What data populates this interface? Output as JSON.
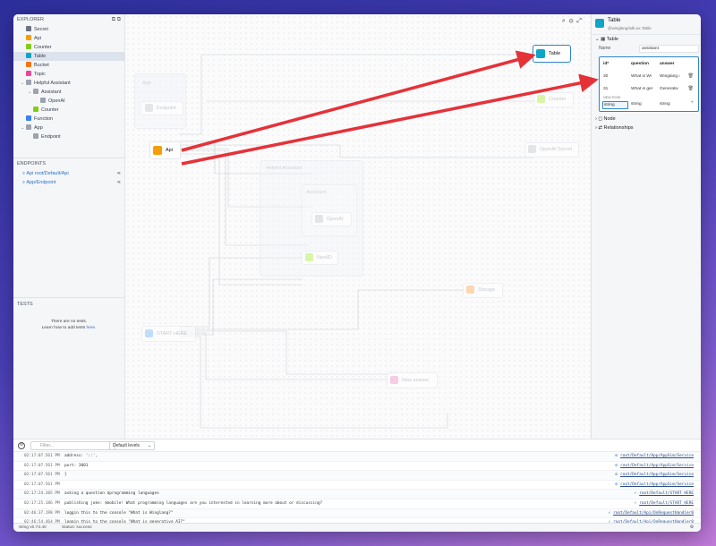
{
  "explorer": {
    "title": "EXPLORER",
    "items": [
      {
        "label": "Secret",
        "color": "#6b7280",
        "indent": 0
      },
      {
        "label": "Api",
        "color": "#f59e0b",
        "indent": 0
      },
      {
        "label": "Counter",
        "color": "#84cc16",
        "indent": 0
      },
      {
        "label": "Table",
        "color": "#0ea5c6",
        "indent": 0,
        "selected": true
      },
      {
        "label": "Bucket",
        "color": "#f97316",
        "indent": 0
      },
      {
        "label": "Topic",
        "color": "#ec4899",
        "indent": 0
      },
      {
        "label": "Helpful Assistant",
        "color": "#9ca3af",
        "indent": 0,
        "expanded": true
      },
      {
        "label": "Assistant",
        "color": "#9ca3af",
        "indent": 1,
        "expanded": true
      },
      {
        "label": "OpenAI",
        "color": "#9ca3af",
        "indent": 2
      },
      {
        "label": "Counter",
        "color": "#84cc16",
        "indent": 1
      },
      {
        "label": "Function",
        "color": "#3b82f6",
        "indent": 0
      },
      {
        "label": "App",
        "color": "#9ca3af",
        "indent": 0,
        "expanded": true
      },
      {
        "label": "Endpoint",
        "color": "#9ca3af",
        "indent": 1
      }
    ]
  },
  "endpoints": {
    "title": "ENDPOINTS",
    "items": [
      "Api root/Default/Api",
      "App/Endpoint"
    ]
  },
  "tests": {
    "title": "TESTS",
    "empty_line1": "There are no tests.",
    "empty_line2": "Learn how to add tests",
    "link": "here."
  },
  "canvas": {
    "nodes": {
      "table": "Table",
      "app": "App",
      "endpoint": "Endpoint",
      "counter": "Counter",
      "api": "Api",
      "openai_secret": "OpenAI Secret",
      "helpful_assistant": "Helpful Assistant",
      "assistant": "Assistant",
      "openai": "OpenAI",
      "nextid": "NextID",
      "storage": "Storage",
      "start_here": "START HERE",
      "new_answer": "New answer"
    }
  },
  "inspector": {
    "title": "Table",
    "subtitle": "@winglang/sdk.ex.Table",
    "section_table": "Table",
    "name_label": "Name",
    "name_value": "assistant",
    "columns": [
      "id*",
      "question",
      "answer"
    ],
    "rows": [
      {
        "id": "30",
        "question": "What is Wi",
        "answer": "Winglang i"
      },
      {
        "id": "31",
        "question": "What is ger",
        "answer": "Generativ"
      }
    ],
    "new_row_label": "NEW ROW",
    "new_row_values": [
      "string",
      "string",
      "string"
    ],
    "section_node": "Node",
    "section_relationships": "Relationships"
  },
  "console": {
    "filter_placeholder": "Filter...",
    "level": "Default levels",
    "logs": [
      {
        "ts": "02:17:07.561 PM",
        "msg": "address: '::',",
        "src": "root/Default/App/AppSim/Service"
      },
      {
        "ts": "02:17:07.561 PM",
        "msg": "port: 3001",
        "src": "root/Default/App/AppSim/Service"
      },
      {
        "ts": "02:17:07.561 PM",
        "msg": "}",
        "src": "root/Default/App/AppSim/Service"
      },
      {
        "ts": "02:17:07.561 PM",
        "msg": "",
        "src": "root/Default/App/AppSim/Service"
      },
      {
        "ts": "02:17:24.205 PM",
        "msg": "asking a question $programming languages",
        "src": "root/Default/START HERE"
      },
      {
        "ts": "02:17:25.186 PM",
        "msg": "publishing joke: $mobile! What programming languages are you interested in learning more about or discussing?",
        "src": "root/Default/START HERE"
      },
      {
        "ts": "02:46:37.198 PM",
        "msg": "loggin this to the console \"What is Winglang?\"",
        "src": "root/Default/Api/OnRequestHandler0"
      },
      {
        "ts": "02:46:54.464 PM",
        "msg": "loggin this to the console \"What is generative AI?\"",
        "src": "root/Default/Api/OnRequestHandler0"
      }
    ]
  },
  "statusbar": {
    "version": "Wing v0.73.40",
    "status_label": "Status:",
    "status_value": "success"
  }
}
